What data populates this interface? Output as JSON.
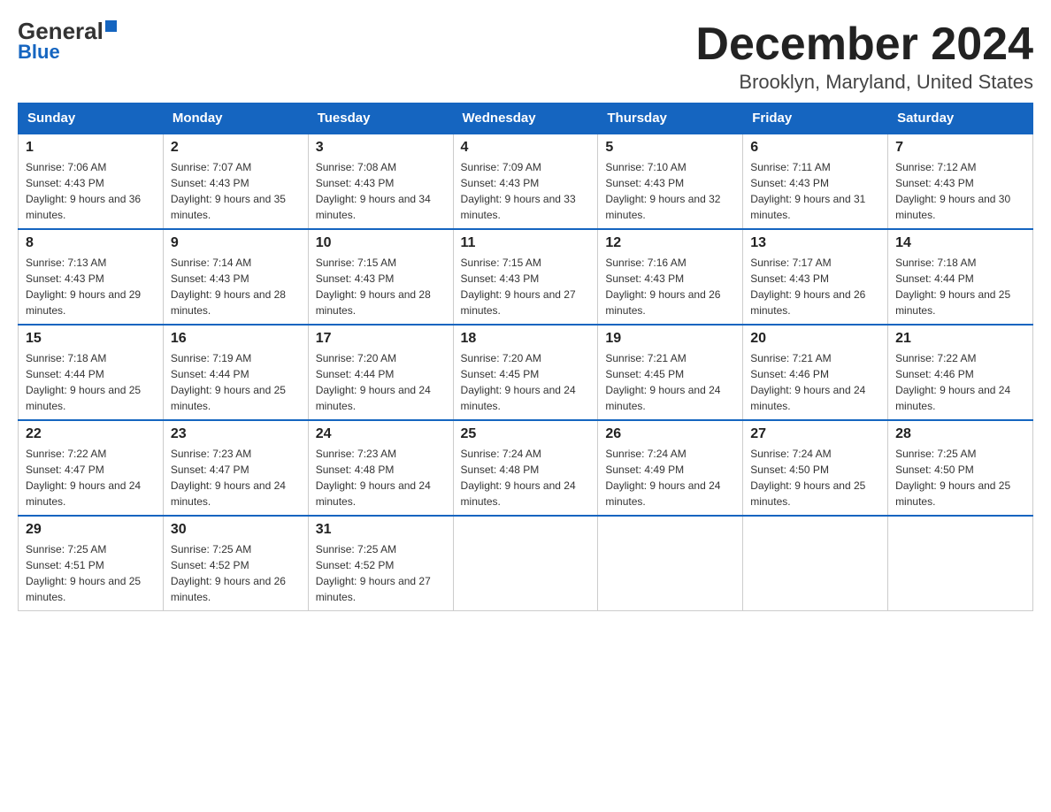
{
  "header": {
    "logo": {
      "general": "General",
      "blue": "Blue"
    },
    "title": "December 2024",
    "location": "Brooklyn, Maryland, United States"
  },
  "days_of_week": [
    "Sunday",
    "Monday",
    "Tuesday",
    "Wednesday",
    "Thursday",
    "Friday",
    "Saturday"
  ],
  "weeks": [
    [
      {
        "day": "1",
        "sunrise": "7:06 AM",
        "sunset": "4:43 PM",
        "daylight": "9 hours and 36 minutes."
      },
      {
        "day": "2",
        "sunrise": "7:07 AM",
        "sunset": "4:43 PM",
        "daylight": "9 hours and 35 minutes."
      },
      {
        "day": "3",
        "sunrise": "7:08 AM",
        "sunset": "4:43 PM",
        "daylight": "9 hours and 34 minutes."
      },
      {
        "day": "4",
        "sunrise": "7:09 AM",
        "sunset": "4:43 PM",
        "daylight": "9 hours and 33 minutes."
      },
      {
        "day": "5",
        "sunrise": "7:10 AM",
        "sunset": "4:43 PM",
        "daylight": "9 hours and 32 minutes."
      },
      {
        "day": "6",
        "sunrise": "7:11 AM",
        "sunset": "4:43 PM",
        "daylight": "9 hours and 31 minutes."
      },
      {
        "day": "7",
        "sunrise": "7:12 AM",
        "sunset": "4:43 PM",
        "daylight": "9 hours and 30 minutes."
      }
    ],
    [
      {
        "day": "8",
        "sunrise": "7:13 AM",
        "sunset": "4:43 PM",
        "daylight": "9 hours and 29 minutes."
      },
      {
        "day": "9",
        "sunrise": "7:14 AM",
        "sunset": "4:43 PM",
        "daylight": "9 hours and 28 minutes."
      },
      {
        "day": "10",
        "sunrise": "7:15 AM",
        "sunset": "4:43 PM",
        "daylight": "9 hours and 28 minutes."
      },
      {
        "day": "11",
        "sunrise": "7:15 AM",
        "sunset": "4:43 PM",
        "daylight": "9 hours and 27 minutes."
      },
      {
        "day": "12",
        "sunrise": "7:16 AM",
        "sunset": "4:43 PM",
        "daylight": "9 hours and 26 minutes."
      },
      {
        "day": "13",
        "sunrise": "7:17 AM",
        "sunset": "4:43 PM",
        "daylight": "9 hours and 26 minutes."
      },
      {
        "day": "14",
        "sunrise": "7:18 AM",
        "sunset": "4:44 PM",
        "daylight": "9 hours and 25 minutes."
      }
    ],
    [
      {
        "day": "15",
        "sunrise": "7:18 AM",
        "sunset": "4:44 PM",
        "daylight": "9 hours and 25 minutes."
      },
      {
        "day": "16",
        "sunrise": "7:19 AM",
        "sunset": "4:44 PM",
        "daylight": "9 hours and 25 minutes."
      },
      {
        "day": "17",
        "sunrise": "7:20 AM",
        "sunset": "4:44 PM",
        "daylight": "9 hours and 24 minutes."
      },
      {
        "day": "18",
        "sunrise": "7:20 AM",
        "sunset": "4:45 PM",
        "daylight": "9 hours and 24 minutes."
      },
      {
        "day": "19",
        "sunrise": "7:21 AM",
        "sunset": "4:45 PM",
        "daylight": "9 hours and 24 minutes."
      },
      {
        "day": "20",
        "sunrise": "7:21 AM",
        "sunset": "4:46 PM",
        "daylight": "9 hours and 24 minutes."
      },
      {
        "day": "21",
        "sunrise": "7:22 AM",
        "sunset": "4:46 PM",
        "daylight": "9 hours and 24 minutes."
      }
    ],
    [
      {
        "day": "22",
        "sunrise": "7:22 AM",
        "sunset": "4:47 PM",
        "daylight": "9 hours and 24 minutes."
      },
      {
        "day": "23",
        "sunrise": "7:23 AM",
        "sunset": "4:47 PM",
        "daylight": "9 hours and 24 minutes."
      },
      {
        "day": "24",
        "sunrise": "7:23 AM",
        "sunset": "4:48 PM",
        "daylight": "9 hours and 24 minutes."
      },
      {
        "day": "25",
        "sunrise": "7:24 AM",
        "sunset": "4:48 PM",
        "daylight": "9 hours and 24 minutes."
      },
      {
        "day": "26",
        "sunrise": "7:24 AM",
        "sunset": "4:49 PM",
        "daylight": "9 hours and 24 minutes."
      },
      {
        "day": "27",
        "sunrise": "7:24 AM",
        "sunset": "4:50 PM",
        "daylight": "9 hours and 25 minutes."
      },
      {
        "day": "28",
        "sunrise": "7:25 AM",
        "sunset": "4:50 PM",
        "daylight": "9 hours and 25 minutes."
      }
    ],
    [
      {
        "day": "29",
        "sunrise": "7:25 AM",
        "sunset": "4:51 PM",
        "daylight": "9 hours and 25 minutes."
      },
      {
        "day": "30",
        "sunrise": "7:25 AM",
        "sunset": "4:52 PM",
        "daylight": "9 hours and 26 minutes."
      },
      {
        "day": "31",
        "sunrise": "7:25 AM",
        "sunset": "4:52 PM",
        "daylight": "9 hours and 27 minutes."
      },
      null,
      null,
      null,
      null
    ]
  ]
}
